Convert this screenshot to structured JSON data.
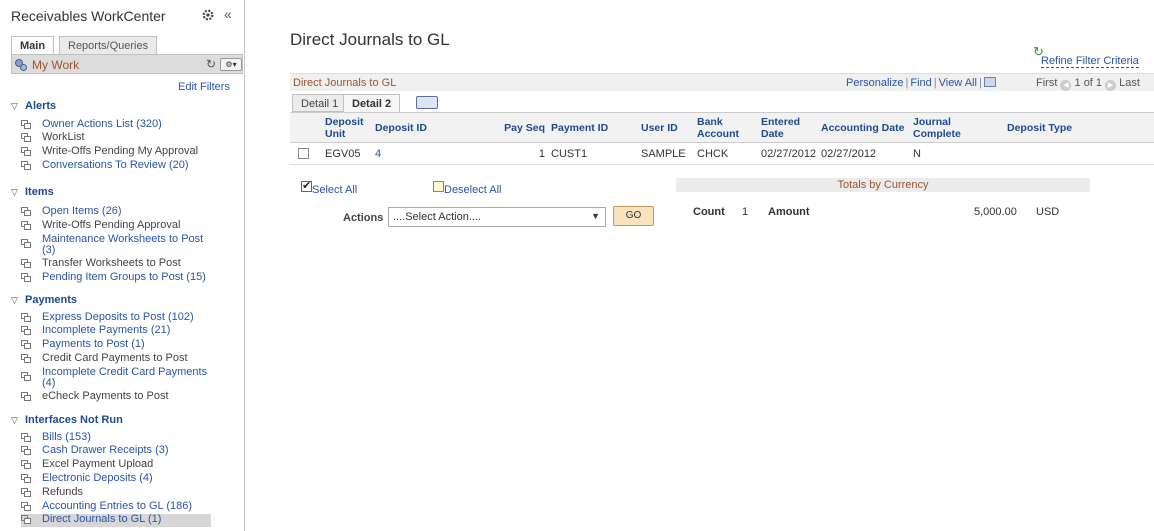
{
  "sidebar": {
    "title": "Receivables WorkCenter",
    "tabs": [
      "Main",
      "Reports/Queries"
    ],
    "my_work": "My Work",
    "edit_filters": "Edit Filters",
    "sections": [
      {
        "label": "Alerts",
        "items": [
          {
            "label": "Owner Actions List (320)",
            "link": true
          },
          {
            "label": "WorkList",
            "link": false
          },
          {
            "label": "Write-Offs Pending My Approval",
            "link": false
          },
          {
            "label": "Conversations To Review (20)",
            "link": true
          }
        ]
      },
      {
        "label": "Items",
        "items": [
          {
            "label": "Open Items (26)",
            "link": true
          },
          {
            "label": "Write-Offs Pending Approval",
            "link": false
          },
          {
            "label": "Maintenance Worksheets to Post (3)",
            "link": true
          },
          {
            "label": "Transfer Worksheets to Post",
            "link": false
          },
          {
            "label": "Pending Item Groups to Post (15)",
            "link": true
          }
        ]
      },
      {
        "label": "Payments",
        "items": [
          {
            "label": "Express Deposits to Post (102)",
            "link": true
          },
          {
            "label": "Incomplete Payments (21)",
            "link": true
          },
          {
            "label": "Payments to Post (1)",
            "link": true
          },
          {
            "label": "Credit Card Payments to Post",
            "link": false
          },
          {
            "label": "Incomplete Credit Card Payments (4)",
            "link": true
          },
          {
            "label": "eCheck Payments to Post",
            "link": false
          }
        ]
      },
      {
        "label": "Interfaces Not Run",
        "items": [
          {
            "label": "Bills (153)",
            "link": true
          },
          {
            "label": "Cash Drawer Receipts (3)",
            "link": true
          },
          {
            "label": "Excel Payment Upload",
            "link": false
          },
          {
            "label": "Electronic Deposits (4)",
            "link": true
          },
          {
            "label": "Refunds",
            "link": false
          },
          {
            "label": "Accounting Entries to GL (186)",
            "link": true
          },
          {
            "label": "Direct Journals to GL (1)",
            "link": true,
            "selected": true
          }
        ]
      }
    ]
  },
  "main": {
    "title": "Direct Journals to GL",
    "refine_filter": "Refine Filter Criteria",
    "grid": {
      "title": "Direct Journals to GL",
      "personalize": "Personalize",
      "find": "Find",
      "view_all": "View All",
      "first": "First",
      "range": "1 of 1",
      "last": "Last",
      "tabs": [
        "Detail 1",
        "Detail 2"
      ],
      "columns": [
        "",
        "Deposit Unit",
        "Deposit ID",
        "Pay Seq",
        "Payment ID",
        "User ID",
        "Bank Account",
        "Entered Date",
        "Accounting Date",
        "Journal Complete",
        "Deposit Type"
      ],
      "rows": [
        {
          "deposit_unit": "EGV05",
          "deposit_id": "4",
          "pay_seq": "1",
          "payment_id": "CUST1",
          "user_id": "SAMPLE",
          "bank_account": "CHCK",
          "entered_date": "02/27/2012",
          "accounting_date": "02/27/2012",
          "journal_complete": "N",
          "deposit_type": ""
        }
      ]
    },
    "select_all": "Select All",
    "deselect_all": "Deselect All",
    "actions_label": "Actions",
    "actions_value": "....Select Action....",
    "go": "GO",
    "totals": {
      "title": "Totals by Currency",
      "count_label": "Count",
      "count": "1",
      "amount_label": "Amount",
      "amount": "5,000.00",
      "currency": "USD"
    }
  }
}
